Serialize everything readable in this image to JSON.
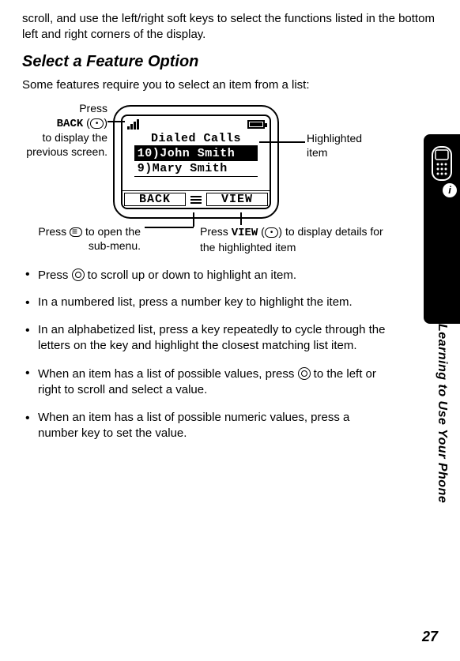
{
  "intro": "scroll, and use the left/right soft keys to select the functions listed in the bottom left and right corners of the display.",
  "heading": "Select a Feature Option",
  "lead": "Some features require you to select an item from a list:",
  "phone": {
    "title": "Dialed Calls",
    "item_highlighted": "10)John Smith",
    "item_next": "9)Mary Smith",
    "soft_left": "BACK",
    "soft_right": "VIEW"
  },
  "callouts": {
    "back_press": "Press",
    "back_label": "BACK",
    "back_rest": "to display the previous screen.",
    "highlighted": "Highlighted item",
    "submenu_press": "Press",
    "submenu_rest": "to open the sub-menu.",
    "view_press": "Press",
    "view_label": "VIEW",
    "view_rest": "to display details for the highlighted item"
  },
  "bullets": [
    "Press  to scroll up or down to highlight an item.",
    "In a numbered list, press a number key to highlight the item.",
    "In an alphabetized list, press a key repeatedly to cycle through the letters on the key and highlight the closest matching list item.",
    "When an item has a list of possible values, press  to the left or right to scroll and select a value.",
    "When an item has a list of possible numeric values, press a number key to set the value."
  ],
  "bullets_text": {
    "b0a": "Press ",
    "b0b": " to scroll up or down to highlight an item.",
    "b1": "In a numbered list, press a number key to highlight the item.",
    "b2": "In an alphabetized list, press a key repeatedly to cycle through the letters on the key and highlight the closest matching list item.",
    "b3a": "When an item has a list of possible values, press ",
    "b3b": " to the left or right to scroll and select a value.",
    "b4": "When an item has a list of possible numeric values, press a number key to set the value."
  },
  "side_label": "Learning to Use Your Phone",
  "page_number": "27"
}
